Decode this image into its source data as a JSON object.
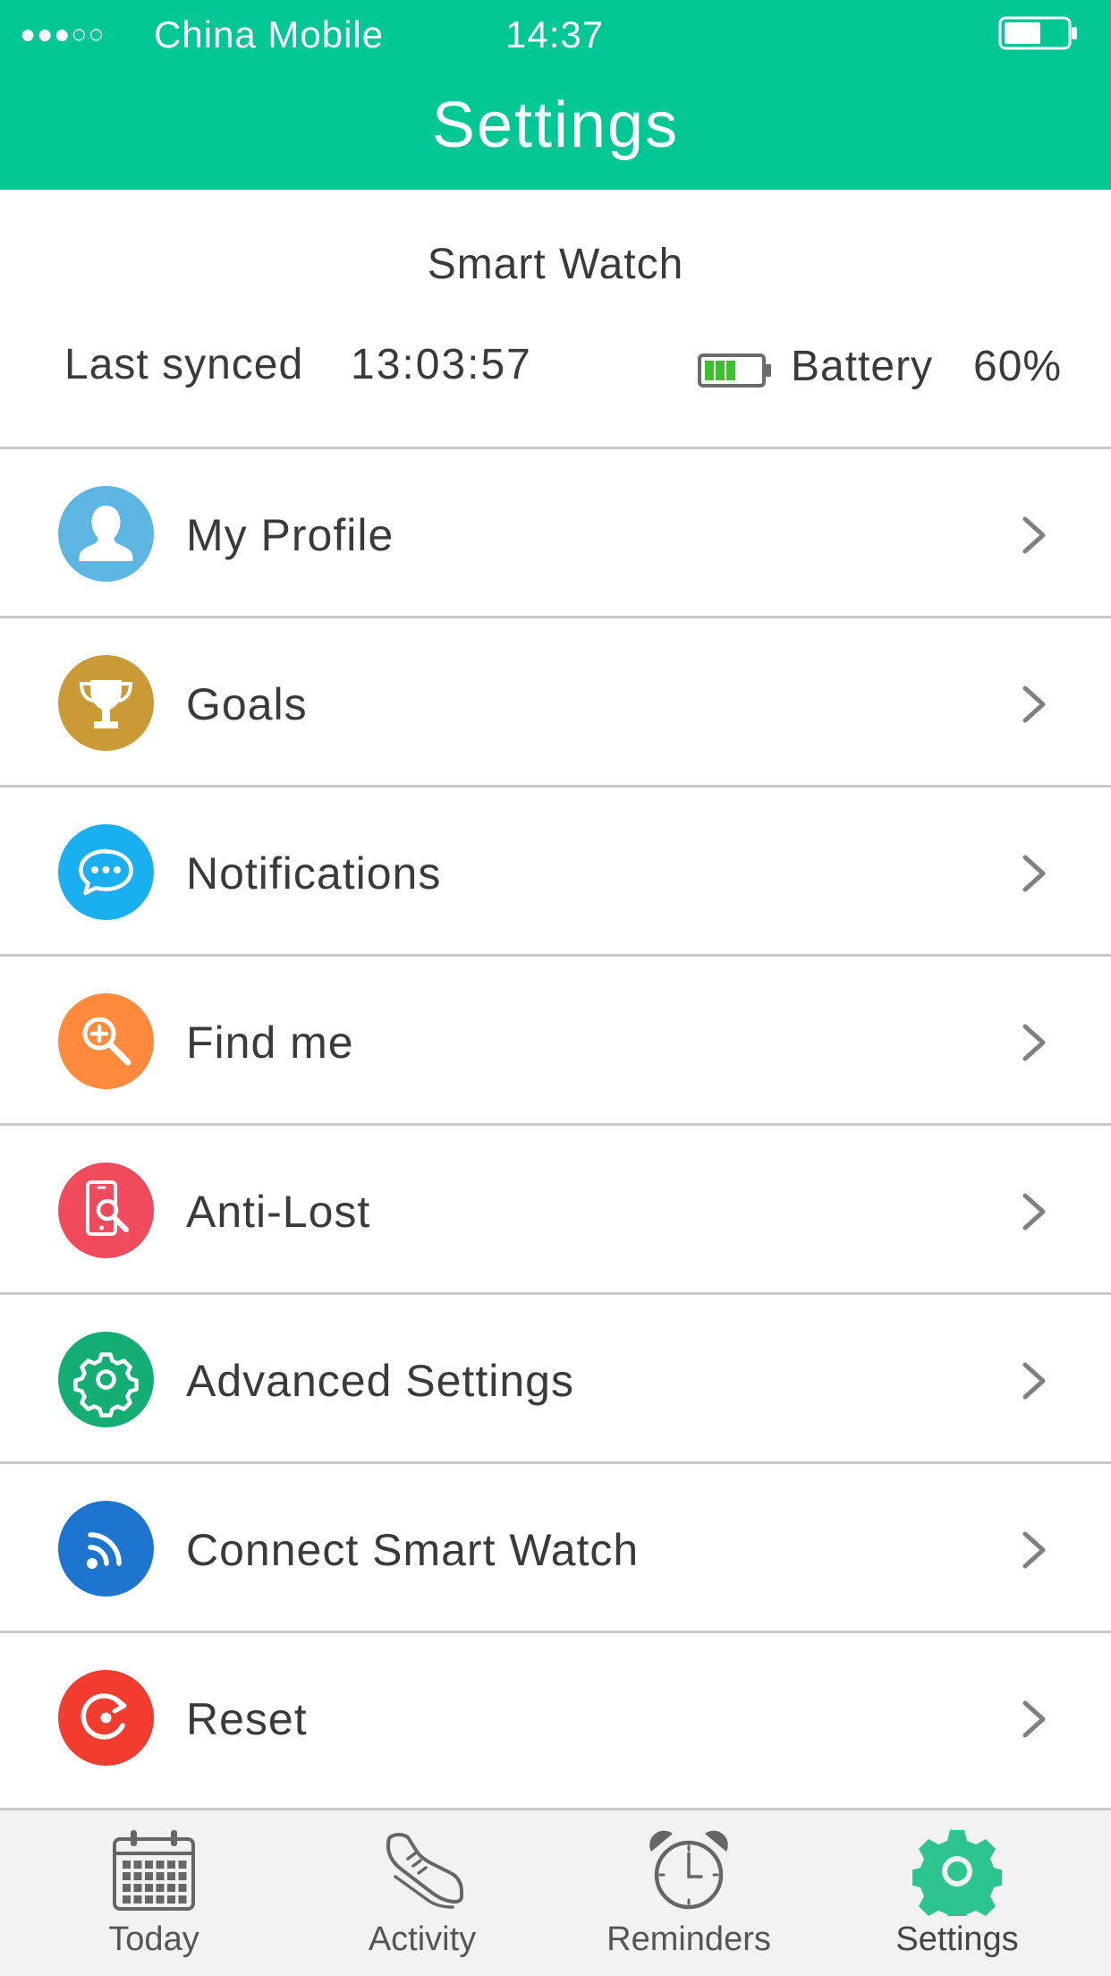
{
  "status_bar": {
    "signal": "●●●○○",
    "carrier": "China Mobile",
    "time": "14:37"
  },
  "header": {
    "title": "Settings"
  },
  "device": {
    "name": "Smart Watch",
    "last_synced_label": "Last synced",
    "last_synced_time": "13:03:57",
    "battery_label": "Battery",
    "battery_value": "60%",
    "battery_level": 0.6
  },
  "menu": {
    "items": [
      {
        "label": "My Profile",
        "icon": "profile-icon",
        "color": "#5db5e2"
      },
      {
        "label": "Goals",
        "icon": "trophy-icon",
        "color": "#c99a35"
      },
      {
        "label": "Notifications",
        "icon": "chat-bubble-icon",
        "color": "#1ab0ef"
      },
      {
        "label": "Find me",
        "icon": "zoom-search-icon",
        "color": "#ff8a3d"
      },
      {
        "label": "Anti-Lost",
        "icon": "phone-search-icon",
        "color": "#ef4b5c"
      },
      {
        "label": "Advanced Settings",
        "icon": "gear-icon",
        "color": "#14ad74"
      },
      {
        "label": "Connect Smart Watch",
        "icon": "wireless-icon",
        "color": "#1e75d0"
      },
      {
        "label": "Reset",
        "icon": "reset-icon",
        "color": "#f23c2f"
      }
    ]
  },
  "tabbar": {
    "tabs": [
      {
        "label": "Today",
        "icon": "calendar-icon"
      },
      {
        "label": "Activity",
        "icon": "sneaker-icon"
      },
      {
        "label": "Reminders",
        "icon": "alarm-clock-icon"
      },
      {
        "label": "Settings",
        "icon": "gear-icon",
        "active": true
      }
    ],
    "active_color": "#2ec48f",
    "inactive_color": "#666666"
  }
}
